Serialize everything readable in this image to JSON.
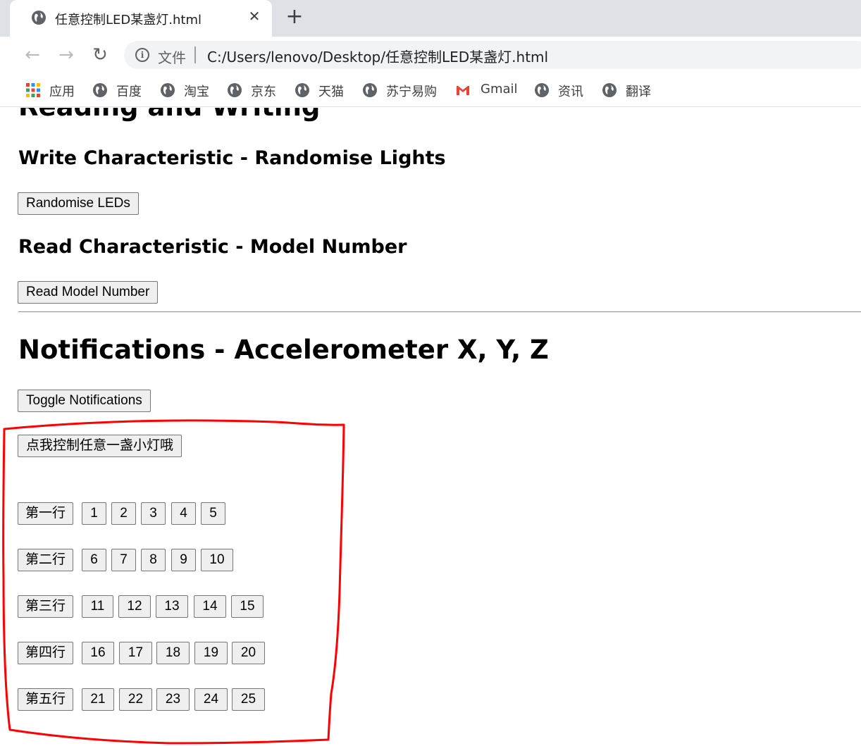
{
  "browser": {
    "tab_title": "任意控制LED某盏灯.html",
    "tab_close": "✕",
    "new_tab": "+",
    "address_label": "文件",
    "address_url": "C:/Users/lenovo/Desktop/任意控制LED某盏灯.html",
    "nav": {
      "back": "←",
      "forward": "→",
      "reload": "↻"
    },
    "bookmarks": [
      "应用",
      "百度",
      "淘宝",
      "京东",
      "天猫",
      "苏宁易购",
      "Gmail",
      "资讯",
      "翻译"
    ]
  },
  "page": {
    "heading_reading_writing": "Reading and Writing",
    "write_heading": "Write Characteristic - Randomise Lights",
    "randomise_button": "Randomise LEDs",
    "read_heading": "Read Characteristic - Model Number",
    "read_button": "Read Model Number",
    "notifications_heading": "Notifications - Accelerometer X, Y, Z",
    "toggle_button": "Toggle Notifications",
    "control_button": "点我控制任意一盏小灯哦",
    "rows": [
      {
        "label": "第一行",
        "buttons": [
          "1",
          "2",
          "3",
          "4",
          "5"
        ]
      },
      {
        "label": "第二行",
        "buttons": [
          "6",
          "7",
          "8",
          "9",
          "10"
        ]
      },
      {
        "label": "第三行",
        "buttons": [
          "11",
          "12",
          "13",
          "14",
          "15"
        ]
      },
      {
        "label": "第四行",
        "buttons": [
          "16",
          "17",
          "18",
          "19",
          "20"
        ]
      },
      {
        "label": "第五行",
        "buttons": [
          "21",
          "22",
          "23",
          "24",
          "25"
        ]
      }
    ]
  },
  "colors": {
    "annotation": "#ff0000",
    "tabstrip": "#dee1e6",
    "button_bg": "#efefef"
  }
}
